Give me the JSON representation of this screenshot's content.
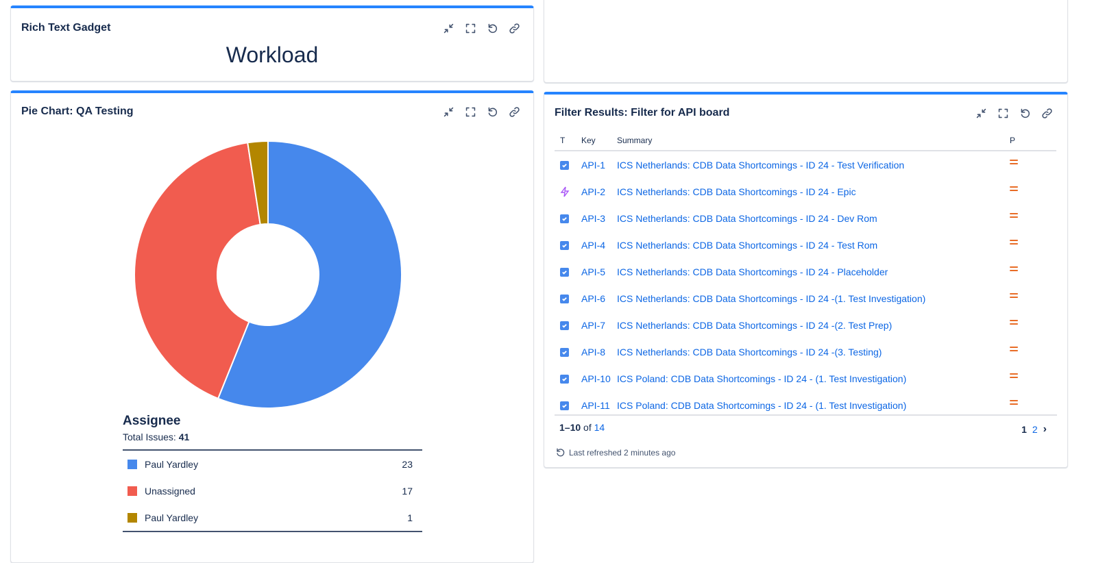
{
  "rich_text_gadget": {
    "title": "Rich Text Gadget",
    "content": "Workload"
  },
  "pie_gadget": {
    "title": "Pie Chart: QA Testing",
    "legend_title": "Assignee",
    "total_label": "Total Issues:",
    "total_value": "41",
    "legend": [
      {
        "name": "Paul Yardley",
        "value": "23",
        "color": "#4688ec"
      },
      {
        "name": "Unassigned",
        "value": "17",
        "color": "#f15c4f"
      },
      {
        "name": "Paul Yardley",
        "value": "1",
        "color": "#b38600"
      }
    ]
  },
  "chart_data": {
    "type": "pie",
    "title": "Pie Chart: QA Testing",
    "categories": [
      "Paul Yardley",
      "Unassigned",
      "Paul Yardley"
    ],
    "values": [
      23,
      17,
      1
    ],
    "colors": [
      "#4688ec",
      "#f15c4f",
      "#b38600"
    ],
    "donut": true,
    "legend": "below"
  },
  "filter_gadget": {
    "title": "Filter Results: Filter for API board",
    "columns": {
      "type": "T",
      "key": "Key",
      "summary": "Summary",
      "priority": "P"
    },
    "rows": [
      {
        "type": "task",
        "key": "API-1",
        "summary": "ICS Netherlands: CDB Data Shortcomings - ID 24 - Test Verification"
      },
      {
        "type": "epic",
        "key": "API-2",
        "summary": "ICS Netherlands: CDB Data Shortcomings - ID 24 - Epic"
      },
      {
        "type": "task",
        "key": "API-3",
        "summary": "ICS Netherlands: CDB Data Shortcomings - ID 24 - Dev Rom"
      },
      {
        "type": "task",
        "key": "API-4",
        "summary": "ICS Netherlands: CDB Data Shortcomings - ID 24 - Test Rom"
      },
      {
        "type": "task",
        "key": "API-5",
        "summary": "ICS Netherlands: CDB Data Shortcomings - ID 24 - Placeholder"
      },
      {
        "type": "task",
        "key": "API-6",
        "summary": "ICS Netherlands: CDB Data Shortcomings - ID 24 -(1. Test Investigation)"
      },
      {
        "type": "task",
        "key": "API-7",
        "summary": "ICS Netherlands: CDB Data Shortcomings - ID 24 -(2. Test Prep)"
      },
      {
        "type": "task",
        "key": "API-8",
        "summary": "ICS Netherlands: CDB Data Shortcomings - ID 24 -(3. Testing)"
      },
      {
        "type": "task",
        "key": "API-10",
        "summary": "ICS Poland: CDB Data Shortcomings - ID 24 - (1. Test Investigation)"
      },
      {
        "type": "task",
        "key": "API-11",
        "summary": "ICS Poland: CDB Data Shortcomings - ID 24 - (1. Test Investigation)"
      }
    ],
    "range": "1–10",
    "of_label": "of",
    "total": "14",
    "pages": [
      "1",
      "2"
    ],
    "last_refreshed": "Last refreshed 2 minutes ago"
  }
}
